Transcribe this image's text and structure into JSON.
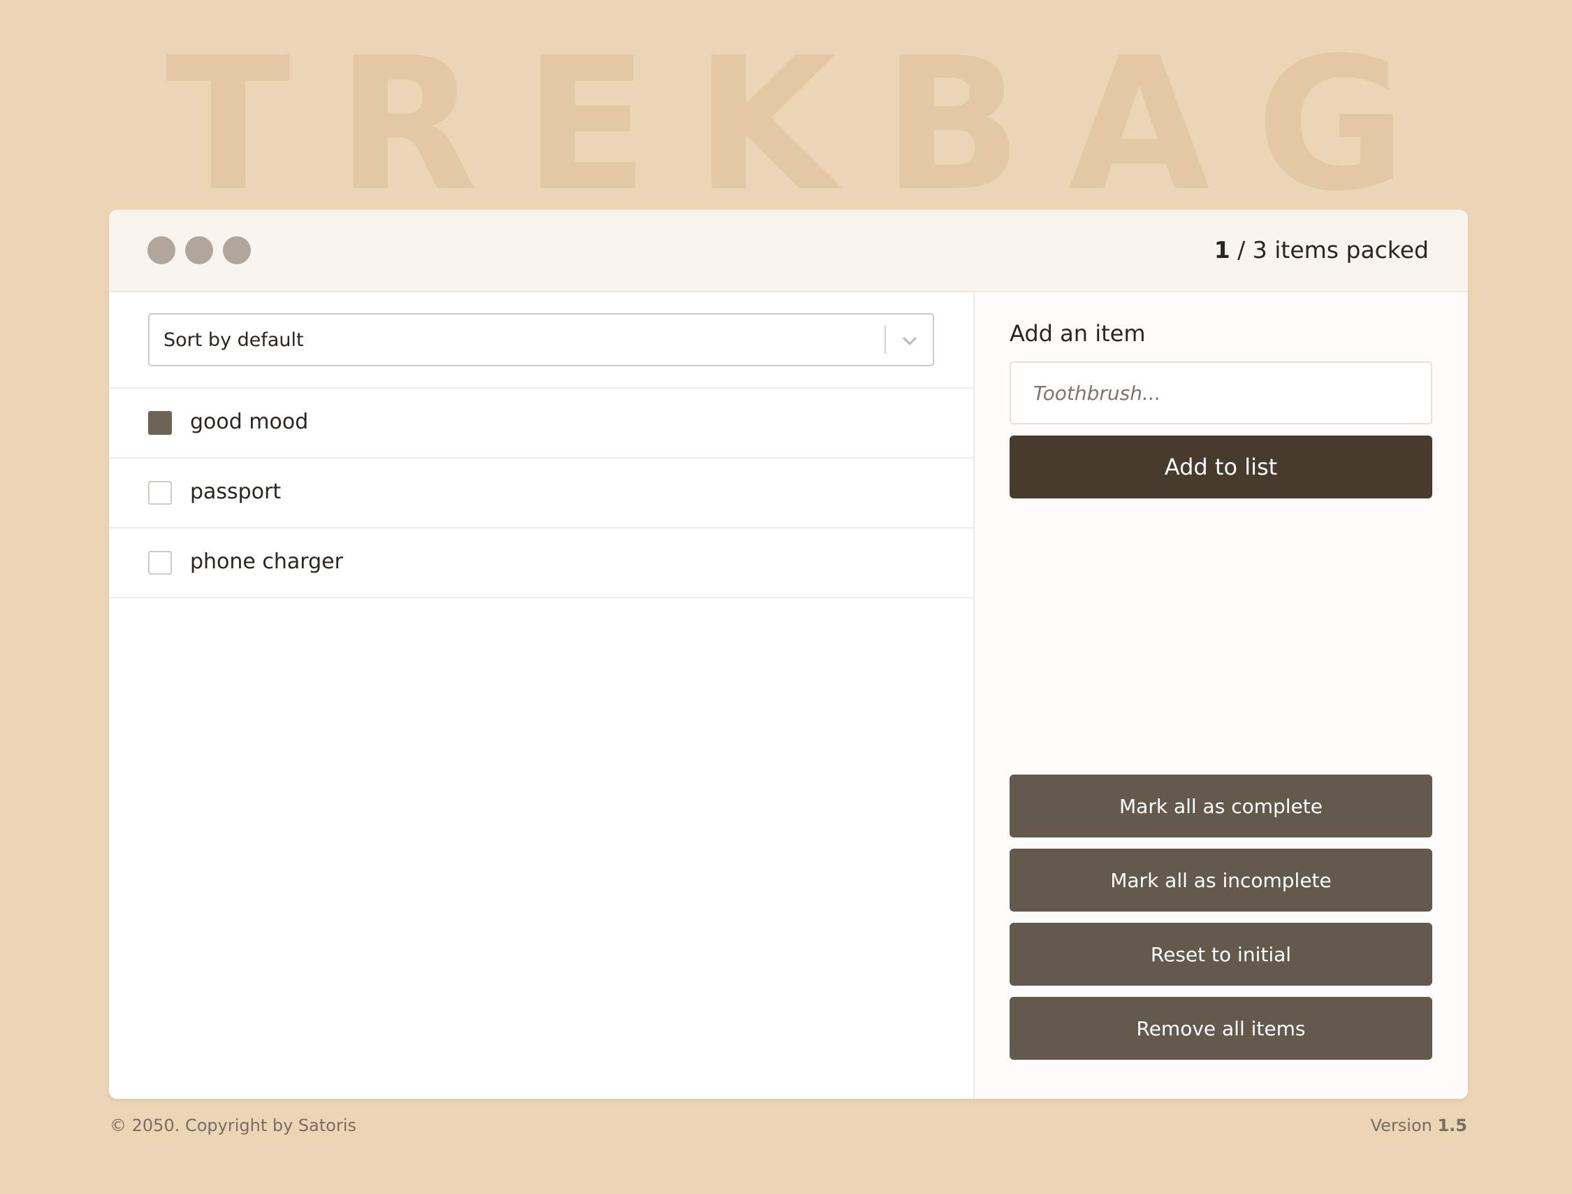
{
  "background_title": "TREKBAG",
  "header": {
    "packed_count": "1",
    "counter_suffix": " / 3 items packed"
  },
  "list": {
    "sort": {
      "selected": "Sort by default"
    },
    "items": [
      {
        "label": "good mood",
        "packed": true
      },
      {
        "label": "passport",
        "packed": false
      },
      {
        "label": "phone charger",
        "packed": false
      }
    ]
  },
  "sidebar": {
    "heading": "Add an item",
    "input_placeholder": "Toothbrush...",
    "add_button": "Add to list",
    "buttons": {
      "mark_complete": "Mark all as complete",
      "mark_incomplete": "Mark all as incomplete",
      "reset": "Reset to initial",
      "remove_all": "Remove all items"
    }
  },
  "footer": {
    "copyright": "© 2050. Copyright by Satoris",
    "version_label": "Version ",
    "version_number": "1.5"
  },
  "colors": {
    "page_background": "#ecd5b5",
    "primary_button": "#463b2d",
    "secondary_button": "#63594c",
    "delete_icon": "#d23a2a",
    "checked_box": "#6e6456"
  },
  "icons": {
    "window_controls": "dot",
    "sort_dropdown": "chevron-down-icon",
    "delete": "x-icon"
  }
}
